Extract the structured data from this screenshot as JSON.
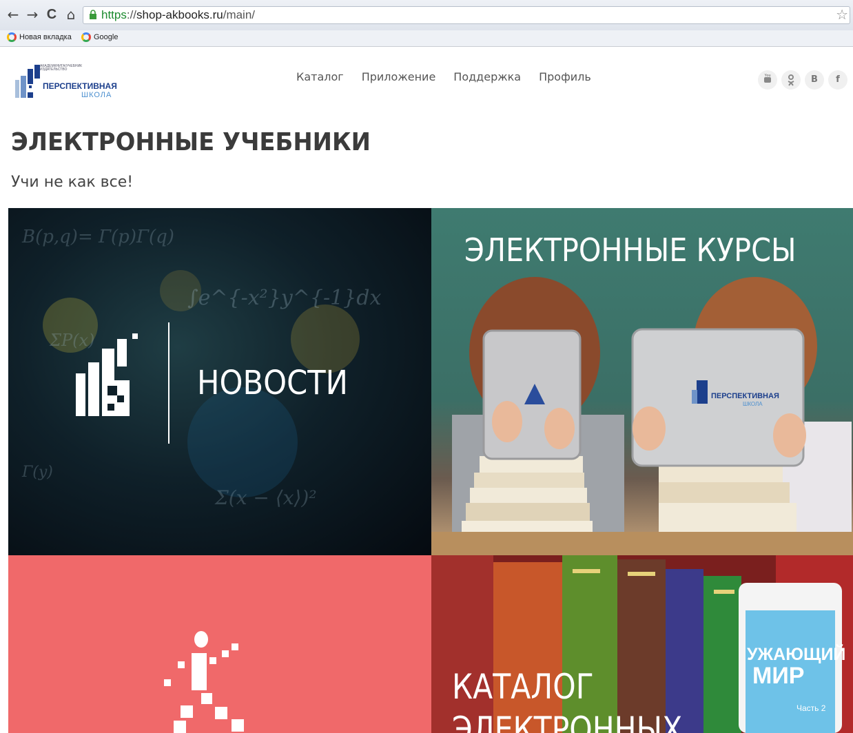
{
  "browser": {
    "nav": {
      "back": "←",
      "forward": "→",
      "reload": "C",
      "home": "⌂"
    },
    "url_scheme": "https",
    "url_sep": "://",
    "url_host": "shop-akbooks.ru",
    "url_path": "/main/",
    "bookmarks": [
      {
        "label": "Новая вкладка"
      },
      {
        "label": "Google"
      }
    ]
  },
  "logo": {
    "small_line1": "АКАДЕМКНИГА/УЧЕБНИК",
    "small_line2": "ИЗДАТЕЛЬСТВО",
    "title": "ПЕРСПЕКТИВНАЯ",
    "subtitle": "ШКОЛА"
  },
  "nav": [
    "Каталог",
    "Приложение",
    "Поддержка",
    "Профиль"
  ],
  "socials": [
    {
      "icon": "youtube-icon",
      "glyph": "▬"
    },
    {
      "icon": "odnoklassniki-icon",
      "glyph": "ok"
    },
    {
      "icon": "vk-icon",
      "glyph": "B"
    },
    {
      "icon": "facebook-icon",
      "glyph": "f"
    }
  ],
  "page": {
    "title": "ЭЛЕКТРОННЫЕ УЧЕБНИКИ",
    "subtitle": "Учи не как все!"
  },
  "tiles": {
    "news": "НОВОСТИ",
    "courses": "ЭЛЕКТРОННЫЕ КУРСЫ",
    "catalog_line1": "КАТАЛОГ",
    "catalog_line2": "ЭЛЕКТРОННЫХ",
    "book_cover_line1": "УЖАЮЩИЙ",
    "book_cover_line2": "МИР",
    "book_part": "Часть 2"
  },
  "colors": {
    "red_tile": "#f0696a",
    "logo_blue": "#1c3f8c",
    "courses_green": "#3f7b70"
  }
}
